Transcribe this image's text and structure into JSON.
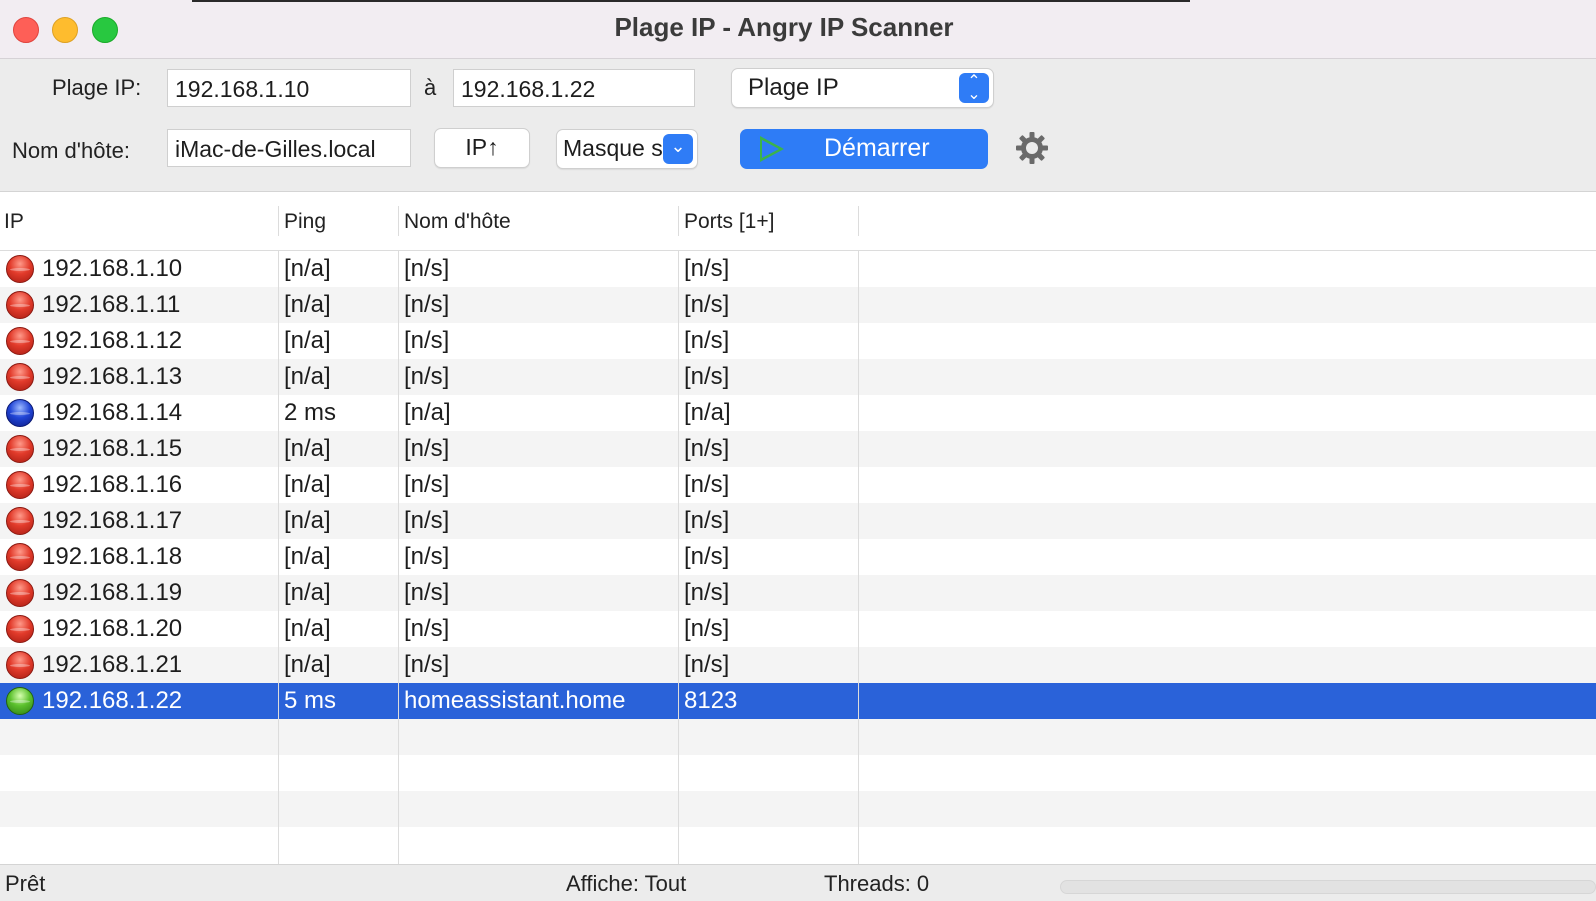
{
  "window": {
    "title": "Plage IP - Angry IP Scanner"
  },
  "toolbar": {
    "ip_range_label": "Plage IP:",
    "ip_start": "192.168.1.10",
    "to_label": "à",
    "ip_end": "192.168.1.22",
    "feeder_select": "Plage IP",
    "hostname_label": "Nom d'hôte:",
    "hostname_value": "iMac-de-Gilles.local",
    "ip_up_button": "IP↑",
    "netmask_select": "Masque s",
    "start_button": "Démarrer",
    "icons": {
      "settings": "gear-icon",
      "columns": "columns-list-icon",
      "start": "play-icon"
    },
    "colors": {
      "accent": "#2e7cf6",
      "play": "#3cb34a"
    }
  },
  "table": {
    "columns": [
      "IP",
      "Ping",
      "Nom d'hôte",
      "Ports [1+]"
    ],
    "rows": [
      {
        "status": "red",
        "ip": "192.168.1.10",
        "ping": "[n/a]",
        "hostname": "[n/s]",
        "ports": "[n/s]"
      },
      {
        "status": "red",
        "ip": "192.168.1.11",
        "ping": "[n/a]",
        "hostname": "[n/s]",
        "ports": "[n/s]"
      },
      {
        "status": "red",
        "ip": "192.168.1.12",
        "ping": "[n/a]",
        "hostname": "[n/s]",
        "ports": "[n/s]"
      },
      {
        "status": "red",
        "ip": "192.168.1.13",
        "ping": "[n/a]",
        "hostname": "[n/s]",
        "ports": "[n/s]"
      },
      {
        "status": "blue",
        "ip": "192.168.1.14",
        "ping": "2 ms",
        "hostname": "[n/a]",
        "ports": "[n/a]"
      },
      {
        "status": "red",
        "ip": "192.168.1.15",
        "ping": "[n/a]",
        "hostname": "[n/s]",
        "ports": "[n/s]"
      },
      {
        "status": "red",
        "ip": "192.168.1.16",
        "ping": "[n/a]",
        "hostname": "[n/s]",
        "ports": "[n/s]"
      },
      {
        "status": "red",
        "ip": "192.168.1.17",
        "ping": "[n/a]",
        "hostname": "[n/s]",
        "ports": "[n/s]"
      },
      {
        "status": "red",
        "ip": "192.168.1.18",
        "ping": "[n/a]",
        "hostname": "[n/s]",
        "ports": "[n/s]"
      },
      {
        "status": "red",
        "ip": "192.168.1.19",
        "ping": "[n/a]",
        "hostname": "[n/s]",
        "ports": "[n/s]"
      },
      {
        "status": "red",
        "ip": "192.168.1.20",
        "ping": "[n/a]",
        "hostname": "[n/s]",
        "ports": "[n/s]"
      },
      {
        "status": "red",
        "ip": "192.168.1.21",
        "ping": "[n/a]",
        "hostname": "[n/s]",
        "ports": "[n/s]"
      },
      {
        "status": "green",
        "ip": "192.168.1.22",
        "ping": "5 ms",
        "hostname": "homeassistant.home",
        "ports": "8123",
        "selected": true
      }
    ],
    "colors": {
      "selected": "#2a62d9",
      "dead": "#e23b2b",
      "alive": "#2145d6",
      "open_ports": "#5cc12d"
    }
  },
  "status": {
    "state": "Prêt",
    "display": "Affiche: Tout",
    "threads": "Threads: 0",
    "progress": 0
  }
}
